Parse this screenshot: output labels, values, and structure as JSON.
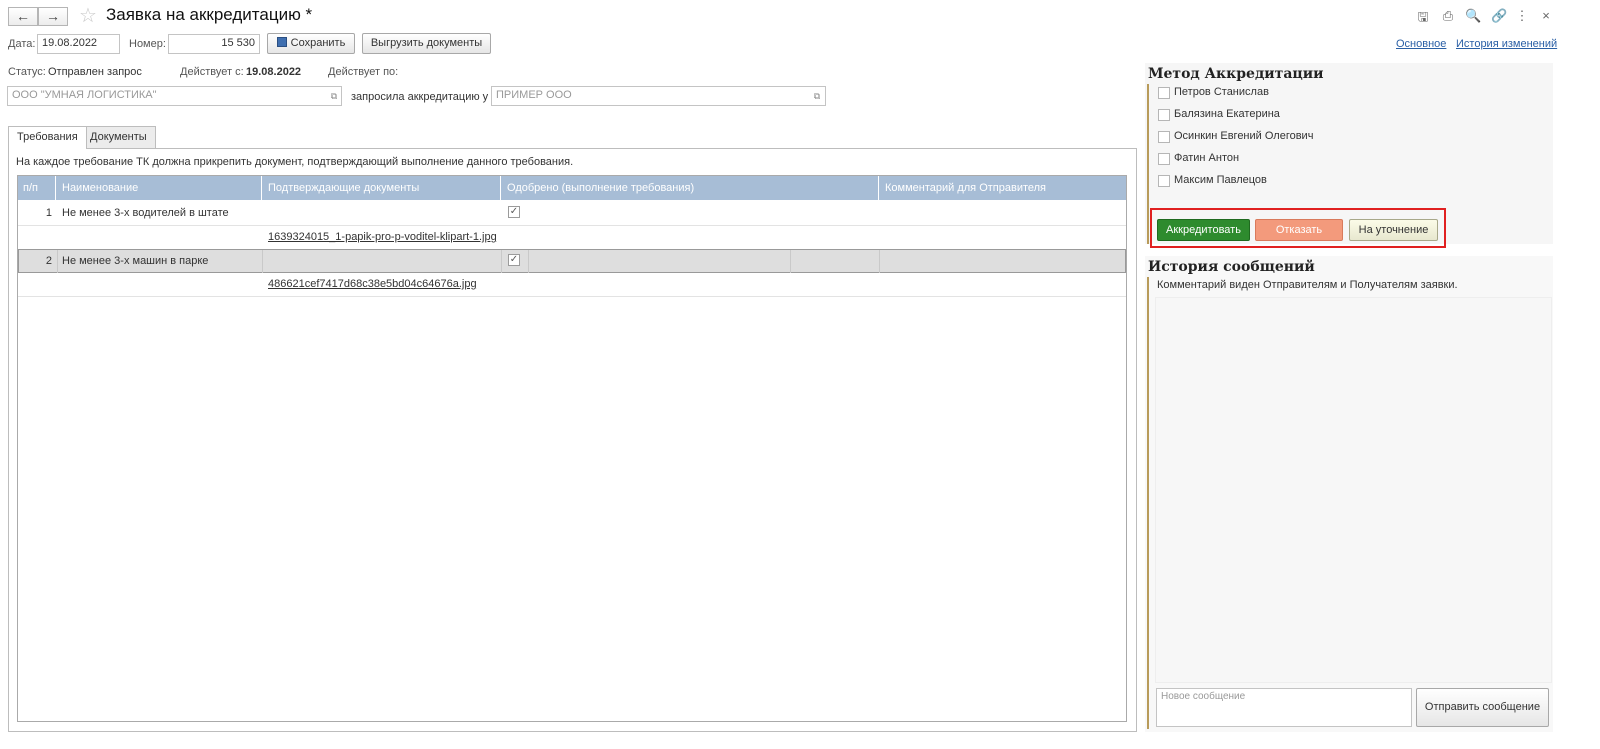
{
  "header": {
    "title": "Заявка на аккредитацию *",
    "back": "←",
    "forward": "→",
    "star": "☆",
    "tools": {
      "save_icon": "🖫",
      "print_icon": "⎙",
      "preview_icon": "🔍",
      "link_icon": "🔗",
      "more_icon": "⋮",
      "close_icon": "×"
    }
  },
  "form": {
    "date_label": "Дата:",
    "date_value": "19.08.2022",
    "number_label": "Номер:",
    "number_value": "15 530",
    "save_label": "Сохранить",
    "export_label": "Выгрузить документы",
    "status_label": "Статус:",
    "status_value": "Отправлен запрос",
    "valid_from_label": "Действует с:",
    "valid_from_value": "19.08.2022",
    "valid_to_label": "Действует по:",
    "company_value": "ООО \"УМНАЯ ЛОГИСТИКА\"",
    "requested_label": "запросила аккредитацию у",
    "partner_value": "ПРИМЕР ООО",
    "pick_icon": "⧉"
  },
  "links": {
    "main": "Основное",
    "history": "История изменений"
  },
  "tabs": {
    "requirements": "Требования",
    "documents": "Документы"
  },
  "requirements": {
    "note": "На каждое требование ТК должна прикрепить документ, подтверждающий выполнение данного требования.",
    "columns": [
      "п/п",
      "Наименование",
      "Подтверждающие документы",
      "Одобрено (выполнение требования)",
      "Комментарий для Отправителя"
    ],
    "rows": [
      {
        "num": "1",
        "name": "Не менее 3-х водителей в штате",
        "approved": "✓",
        "file": "1639324015_1-papik-pro-p-voditel-klipart-1.jpg"
      },
      {
        "num": "2",
        "name": "Не менее 3-х машин в парке",
        "approved": "✓",
        "file": "486621cef7417d68c38e5bd04c64676a.jpg"
      }
    ]
  },
  "accreditation": {
    "title": "Метод Аккредитации",
    "people": [
      "Петров Станислав",
      "Балязина Екатерина",
      "Осинкин Евгений Олегович",
      "Фатин Антон",
      "Максим Павлецов"
    ],
    "accredit_label": "Аккредитовать",
    "reject_label": "Отказать",
    "clarify_label": "На уточнение",
    "colors": {
      "accredit": "#2e8b2e",
      "reject": "#f39a7c",
      "highlight": "#e02020"
    }
  },
  "messages": {
    "title": "История сообщений",
    "note": "Комментарий виден Отправителям и Получателям заявки.",
    "new_placeholder": "Новое сообщение",
    "send_label": "Отправить сообщение"
  }
}
